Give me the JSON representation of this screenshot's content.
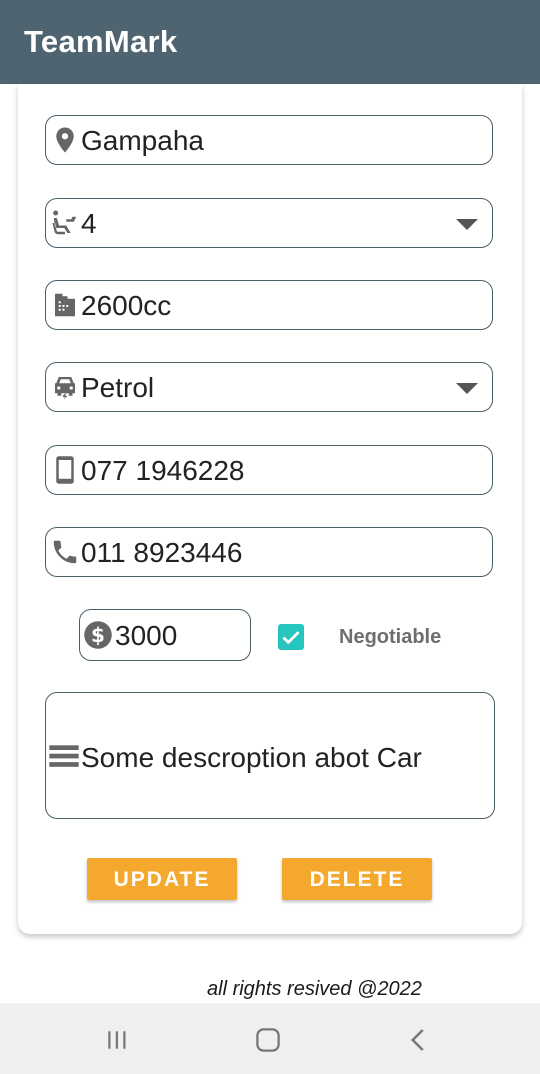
{
  "app": {
    "title": "TeamMark"
  },
  "form": {
    "location": {
      "icon": "location-pin-icon",
      "value": "Gampaha"
    },
    "seats": {
      "icon": "seat-icon",
      "value": "4"
    },
    "engine": {
      "icon": "engine-capacity-icon",
      "value": "2600cc"
    },
    "fuel": {
      "icon": "car-icon",
      "value": "Petrol"
    },
    "mobile": {
      "icon": "mobile-phone-icon",
      "value": "077 1946228"
    },
    "landline": {
      "icon": "phone-icon",
      "value": "011 8923446"
    },
    "price": {
      "icon": "dollar-icon",
      "value": "3000"
    },
    "negotiable": {
      "label": "Negotiable",
      "checked": true
    },
    "description": {
      "icon": "menu-lines-icon",
      "value": "Some descroption abot Car"
    }
  },
  "buttons": {
    "update": "UPDATE",
    "delete": "DELETE"
  },
  "footer": {
    "text": "all rights resived @2022"
  },
  "colors": {
    "appbar": "#4e6571",
    "accent": "#f5a82e",
    "checkbox": "#26c6be"
  }
}
